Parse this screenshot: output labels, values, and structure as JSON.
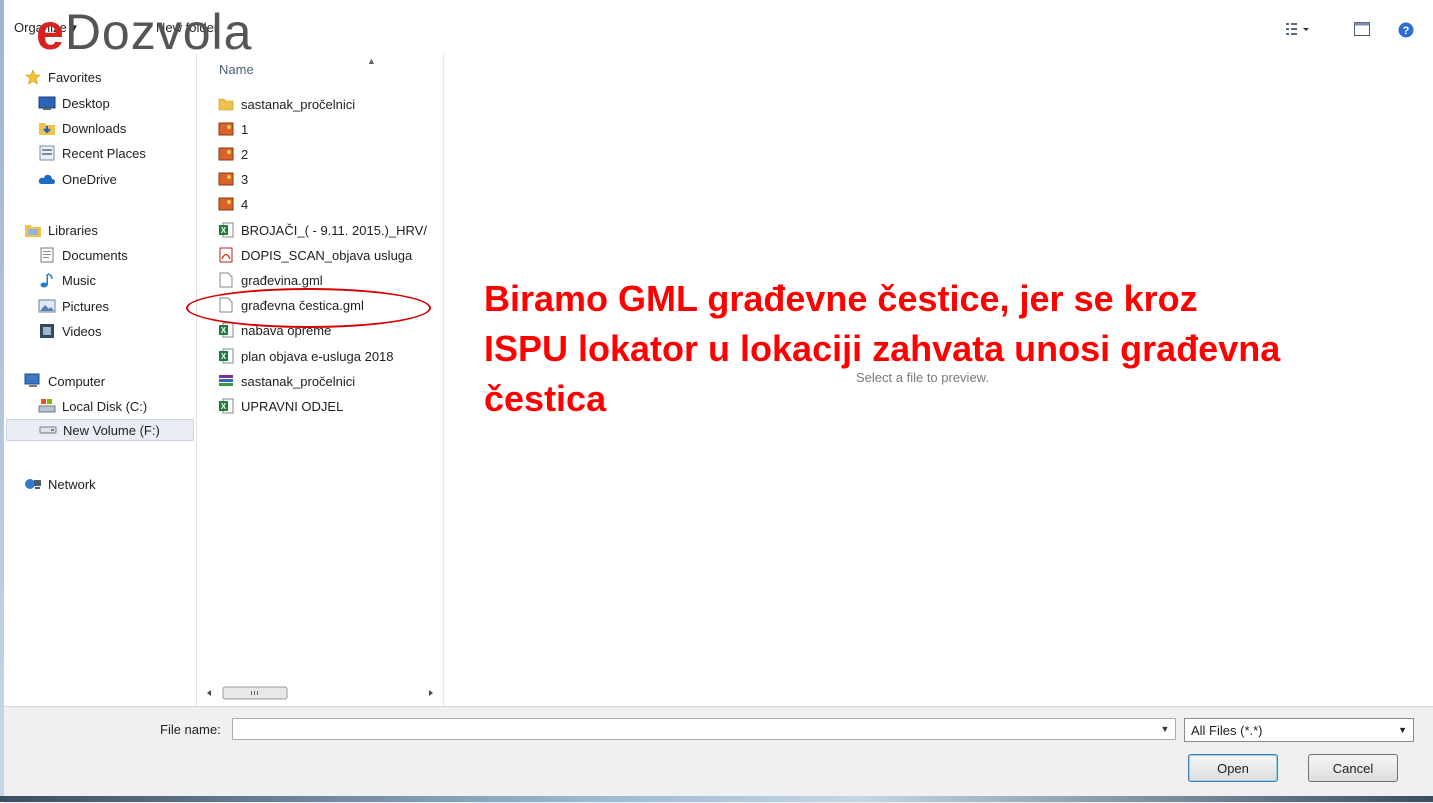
{
  "toolbar": {
    "organize_label": "Organize",
    "new_folder_label": "New folder",
    "logo_e": "e",
    "logo_rest": "Dozvola"
  },
  "nav": {
    "favorites": "Favorites",
    "desktop": "Desktop",
    "downloads": "Downloads",
    "recent_places": "Recent Places",
    "onedrive": "OneDrive",
    "libraries": "Libraries",
    "documents": "Documents",
    "music": "Music",
    "pictures": "Pictures",
    "videos": "Videos",
    "computer": "Computer",
    "local_disk": "Local Disk (C:)",
    "new_volume": "New Volume (F:)",
    "network": "Network"
  },
  "files": {
    "column_name": "Name",
    "items": [
      "sastanak_pročelnici",
      "1",
      "2",
      "3",
      "4",
      "BROJAČI_( - 9.11. 2015.)_HRV/",
      "DOPIS_SCAN_objava usluga",
      "građevina.gml",
      "građevna čestica.gml",
      "nabava opreme",
      "plan objava e-usluga 2018",
      "sastanak_pročelnici",
      "UPRAVNI ODJEL"
    ]
  },
  "preview": {
    "placeholder": "Select a file to preview."
  },
  "annotation": {
    "line1": "Biramo GML građevne čestice, jer se kroz",
    "line2": "ISPU lokator u lokaciji zahvata unosi građevna",
    "line3": "čestica",
    "color": "#ff0000"
  },
  "bottom": {
    "file_name_label": "File name:",
    "file_name_value": "",
    "filter_value": "All Files (*.*)",
    "open_label": "Open",
    "cancel_label": "Cancel"
  }
}
